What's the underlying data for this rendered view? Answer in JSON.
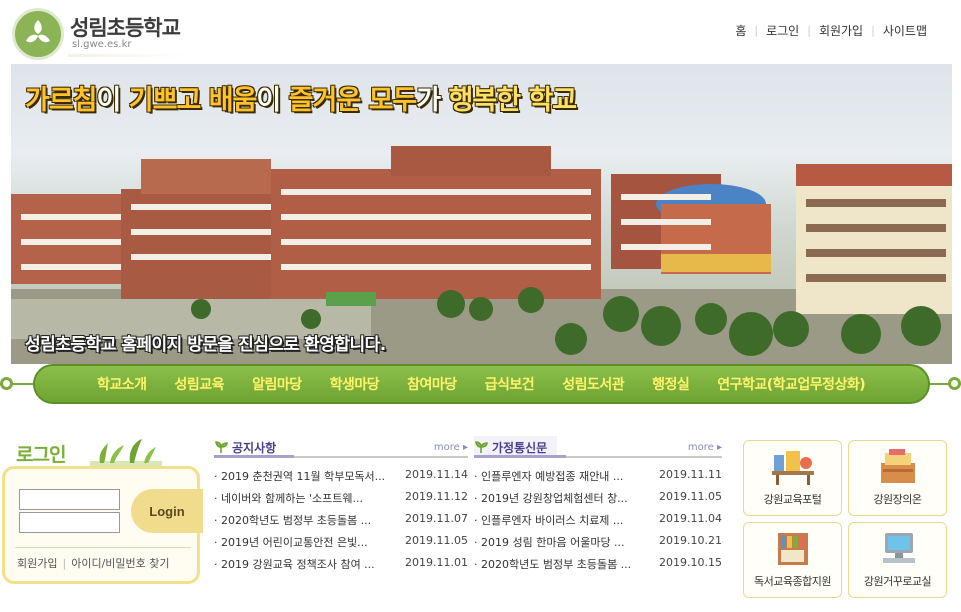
{
  "header": {
    "school_name": "성림초등학교",
    "url_text": "sl.gwe.es.kr",
    "util_links": [
      "홈",
      "로그인",
      "회원가입",
      "사이트맵"
    ]
  },
  "hero": {
    "slogan_parts": [
      "가르침",
      "이 ",
      "기쁘고",
      " ",
      "배움",
      "이 ",
      "즐거운",
      " ",
      "모두",
      "가 ",
      "행복한 학교"
    ],
    "welcome": "성림초등학교 홈페이지 방문을 진심으로 환영합니다."
  },
  "gnb": {
    "items": [
      "학교소개",
      "성림교육",
      "알림마당",
      "학생마당",
      "참여마당",
      "급식보건",
      "성림도서관",
      "행정실",
      "연구학교(학교업무정상화)"
    ]
  },
  "login": {
    "title": "로그인",
    "id_placeholder": "",
    "pw_placeholder": "",
    "button": "Login",
    "links": [
      "회원가입",
      "아이디/비밀번호 찾기"
    ]
  },
  "notice": {
    "title": "공지사항",
    "more": "more",
    "items": [
      {
        "title": "2019 춘천권역 11월 학부모독서...",
        "date": "2019.11.14"
      },
      {
        "title": "네이버와 함께하는 '소프트웨...",
        "date": "2019.11.12"
      },
      {
        "title": "2020학년도 범정부 초등돌봄 ...",
        "date": "2019.11.07"
      },
      {
        "title": "2019년 어린이교통안전 은빛...",
        "date": "2019.11.05"
      },
      {
        "title": "2019 강원교육 정책조사 참여 ...",
        "date": "2019.11.01"
      }
    ]
  },
  "newsletter": {
    "title": "가정통신문",
    "more": "more",
    "items": [
      {
        "title": "인플루엔자 예방접종 재안내 ...",
        "date": "2019.11.11"
      },
      {
        "title": "2019년 강원창업체험센터 창...",
        "date": "2019.11.05"
      },
      {
        "title": "인플루엔자 바이러스 치료제 ...",
        "date": "2019.11.04"
      },
      {
        "title": "2019 성림 한마음 어울마당 ...",
        "date": "2019.10.21"
      },
      {
        "title": "2020학년도 범정부 초등돌봄 ...",
        "date": "2019.10.15"
      }
    ]
  },
  "quick_links": [
    "강원교육포털",
    "강원장의온",
    "독서교육종합지원",
    "강원거꾸로교실"
  ]
}
